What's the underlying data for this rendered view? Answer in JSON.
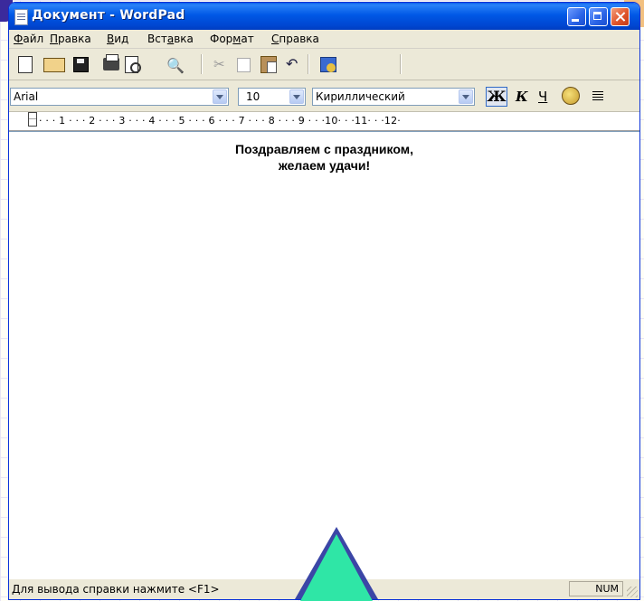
{
  "window": {
    "title": "Документ - WordPad"
  },
  "menubar": {
    "items": [
      {
        "pre": "",
        "key": "Ф",
        "post": "айл"
      },
      {
        "pre": "",
        "key": "П",
        "post": "равка"
      },
      {
        "pre": "",
        "key": "В",
        "post": "ид"
      },
      {
        "pre": "Вст",
        "key": "а",
        "post": "вка"
      },
      {
        "pre": "Фор",
        "key": "м",
        "post": "ат"
      },
      {
        "pre": "",
        "key": "С",
        "post": "правка"
      }
    ]
  },
  "toolbar": {
    "icons": [
      "new-document-icon",
      "open-folder-icon",
      "save-disk-icon",
      "print-icon",
      "print-preview-icon",
      "find-icon",
      "cut-icon",
      "copy-icon",
      "paste-icon",
      "undo-icon",
      "date-time-icon"
    ]
  },
  "format": {
    "font": "Arial",
    "size": "10",
    "script": "Кириллический",
    "bold_label": "Ж",
    "italic_label": "К",
    "underline_label": "Ч"
  },
  "ruler": {
    "text": "· · · 1 · · · 2 · · · 3 · · · 4 · · · 5 · · · 6 · · · 7 · · · 8 · · · 9 · · ·10· · ·11· · ·12·"
  },
  "document": {
    "line1": "Поздравляем с праздником,",
    "line2": "желаем удачи!"
  },
  "status": {
    "help_text": "Для вывода справки нажмите <F1>",
    "num": "NUM"
  },
  "colors": {
    "title_bar": "#0058e6",
    "chrome": "#ece9d8",
    "overlay_triangle": "#2fe6a6"
  }
}
